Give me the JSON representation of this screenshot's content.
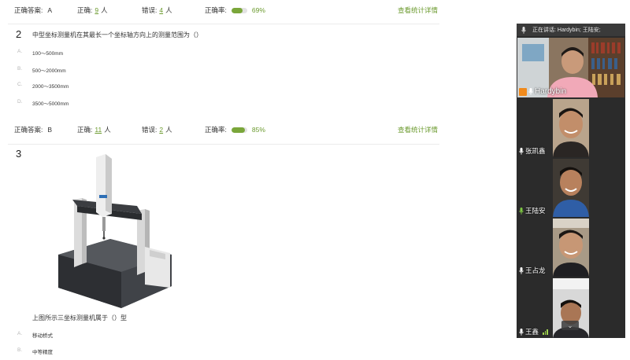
{
  "q1_stats": {
    "answer_label": "正确答案:",
    "answer_value": "A",
    "correct_label": "正确:",
    "correct_count": "9",
    "correct_unit": "人",
    "wrong_label": "错误:",
    "wrong_count": "4",
    "wrong_unit": "人",
    "rate_label": "正确率:",
    "rate_value": "69%",
    "rate_fraction": 0.69,
    "detail_link": "查看统计详情"
  },
  "q2": {
    "number": "2",
    "text": "中型坐标测量机在其最长一个坐标轴方向上的测量范围为（）",
    "options": [
      {
        "letter": "A.",
        "text": "100～500mm"
      },
      {
        "letter": "B.",
        "text": "500～2000mm"
      },
      {
        "letter": "C.",
        "text": "2000～3500mm"
      },
      {
        "letter": "D.",
        "text": "3500～5000mm"
      }
    ]
  },
  "q2_stats": {
    "answer_label": "正确答案:",
    "answer_value": "B",
    "correct_label": "正确:",
    "correct_count": "11",
    "correct_unit": "人",
    "wrong_label": "错误:",
    "wrong_count": "2",
    "wrong_unit": "人",
    "rate_label": "正确率:",
    "rate_value": "85%",
    "rate_fraction": 0.85,
    "detail_link": "查看统计详情"
  },
  "q3": {
    "number": "3",
    "text": "上图所示三坐标测量机属于（）型",
    "options": [
      {
        "letter": "A.",
        "text": "移动桥式"
      },
      {
        "letter": "B.",
        "text": "中等精度"
      }
    ]
  },
  "meeting": {
    "speaking_label": "正在讲话: Hardybin; 王陆安;",
    "participants": [
      {
        "name": "Hardybin"
      },
      {
        "name": "张凯鑫"
      },
      {
        "name": "王陆安"
      },
      {
        "name": "王占龙"
      },
      {
        "name": "王鑫"
      }
    ],
    "colors": {
      "accent": "#7aa63a",
      "host_badge": "#f08a1c",
      "mic_active": "#7ec843"
    }
  }
}
